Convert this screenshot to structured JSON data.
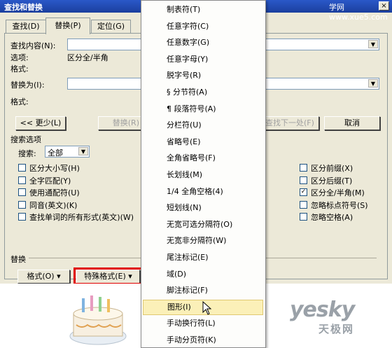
{
  "window": {
    "title": "查找和替换",
    "watermark_top": "学网 www.xue5.com",
    "close_glyph": "×"
  },
  "tabs": [
    {
      "label": "查找(D)"
    },
    {
      "label": "替换(P)"
    },
    {
      "label": "定位(G)"
    }
  ],
  "find": {
    "label": "查找内容(N):",
    "value": "",
    "options_label": "选项:",
    "options_value": "区分全/半角",
    "format_label": "格式:"
  },
  "replace": {
    "label": "替换为(I):",
    "value": "",
    "format_label": "格式:"
  },
  "buttons": {
    "less": "<< 更少(L)",
    "replace": "替换(R)",
    "find_next": "查找下一处(F)",
    "cancel": "取消"
  },
  "search_options": {
    "section_label": "搜索选项",
    "search_label": "搜索:",
    "search_value": "全部",
    "left_checks": [
      {
        "label": "区分大小写(H)",
        "checked": false
      },
      {
        "label": "全字匹配(Y)",
        "checked": false
      },
      {
        "label": "使用通配符(U)",
        "checked": false
      },
      {
        "label": "同音(英文)(K)",
        "checked": false
      },
      {
        "label": "查找单词的所有形式(英文)(W)",
        "checked": false
      }
    ],
    "right_checks": [
      {
        "label": "区分前缀(X)",
        "checked": false
      },
      {
        "label": "区分后缀(T)",
        "checked": false
      },
      {
        "label": "区分全/半角(M)",
        "checked": true
      },
      {
        "label": "忽略标点符号(S)",
        "checked": false
      },
      {
        "label": "忽略空格(A)",
        "checked": false
      }
    ]
  },
  "replace_section": {
    "label": "替换",
    "format_button": "格式(O)",
    "special_button": "特殊格式(E)"
  },
  "special_menu": {
    "items": [
      {
        "label": "制表符(T)"
      },
      {
        "label": "任意字符(C)"
      },
      {
        "label": "任意数字(G)"
      },
      {
        "label": "任意字母(Y)"
      },
      {
        "label": "脱字号(R)"
      },
      {
        "label": "§ 分节符(A)"
      },
      {
        "label": "¶ 段落符号(A)"
      },
      {
        "label": "分栏符(U)"
      },
      {
        "label": "省略号(E)"
      },
      {
        "label": "全角省略号(F)"
      },
      {
        "label": "长划线(M)"
      },
      {
        "label": "1/4 全角空格(4)"
      },
      {
        "label": "短划线(N)"
      },
      {
        "label": "无宽可选分隔符(O)"
      },
      {
        "label": "无宽非分隔符(W)"
      },
      {
        "label": "尾注标记(E)"
      },
      {
        "label": "域(D)"
      },
      {
        "label": "脚注标记(F)"
      },
      {
        "label": "图形(I)"
      },
      {
        "label": "手动换行符(L)"
      },
      {
        "label": "手动分页符(K)"
      }
    ],
    "highlighted_index": 18
  },
  "watermark": {
    "brand": "yesky",
    "brand_cn": "天极网"
  },
  "colors": {
    "title_bar": "#1b3f9e",
    "highlight_box": "#e00000",
    "menu_hover": "#fbf0b8"
  }
}
